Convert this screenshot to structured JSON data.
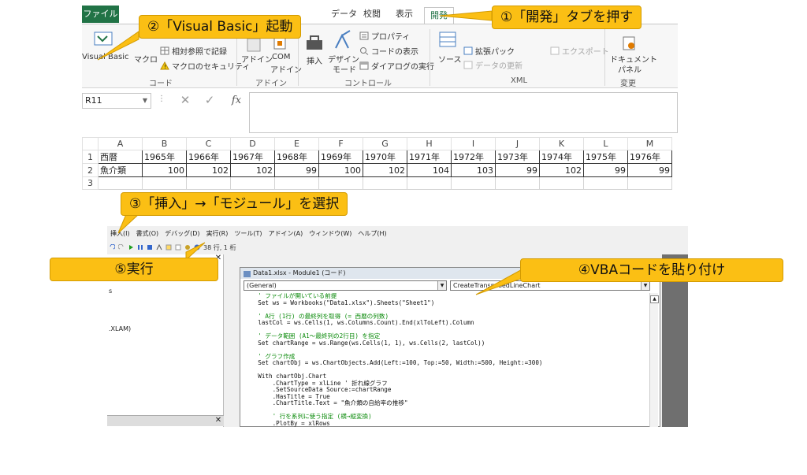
{
  "ribbon": {
    "tabs": [
      "ファイル",
      "データ",
      "校閲",
      "表示",
      "開発"
    ],
    "buttons": {
      "visual_basic": "Visual Basic",
      "macro": "マクロ",
      "relative_ref": "相対参照で記録",
      "macro_security": "マクロのセキュリティ",
      "addin": "アドイン",
      "com_addin_1": "COM",
      "com_addin_2": "アドイン",
      "insert": "挿入",
      "design_mode_1": "デザイン",
      "design_mode_2": "モード",
      "properties": "プロパティ",
      "view_code": "コードの表示",
      "run_dialog": "ダイアログの実行",
      "source": "ソース",
      "expansion_pack": "拡張パック",
      "refresh_data": "データの更新",
      "export": "エクスポート",
      "doc_panel_1": "ドキュメント",
      "doc_panel_2": "パネル"
    },
    "groups": {
      "code": "コード",
      "addin": "アドイン",
      "controls": "コントロール",
      "xml": "XML",
      "modify": "変更"
    }
  },
  "formula_bar": {
    "name_box": "R11",
    "cancel": "✕",
    "enter": "✓",
    "fx": "fx"
  },
  "sheet": {
    "columns": [
      "A",
      "B",
      "C",
      "D",
      "E",
      "F",
      "G",
      "H",
      "I",
      "J",
      "K",
      "L",
      "M"
    ],
    "rows": [
      {
        "num": "1",
        "cells": [
          "西暦",
          "1965年",
          "1966年",
          "1967年",
          "1968年",
          "1969年",
          "1970年",
          "1971年",
          "1972年",
          "1973年",
          "1974年",
          "1975年",
          "1976年"
        ]
      },
      {
        "num": "2",
        "cells": [
          "魚介類",
          "100",
          "102",
          "102",
          "99",
          "100",
          "102",
          "104",
          "103",
          "99",
          "102",
          "99",
          "99"
        ]
      },
      {
        "num": "3",
        "cells": [
          "",
          "",
          "",
          "",
          "",
          "",
          "",
          "",
          "",
          "",
          "",
          "",
          ""
        ]
      }
    ]
  },
  "vbe": {
    "menu": [
      "挿入(I)",
      "書式(O)",
      "デバッグ(D)",
      "実行(R)",
      "ツール(T)",
      "アドイン(A)",
      "ウィンドウ(W)",
      "ヘルプ(H)"
    ],
    "cursor_pos": "38 行, 1 桁",
    "left_text_1": "s",
    "left_text_2": ".XLAM)",
    "window_title": "Data1.xlsx - Module1 (コード)",
    "object_dropdown": "(General)",
    "proc_dropdown": "CreateTransposedLineChart",
    "code": [
      {
        "t": "cm",
        "s": "    ' ファイルが開いている前提"
      },
      {
        "t": "n",
        "s": "    Set ws = Workbooks(\"Data1.xlsx\").Sheets(\"Sheet1\")"
      },
      {
        "t": "n",
        "s": ""
      },
      {
        "t": "cm",
        "s": "    ' A行 (1行) の最終列を取得 (= 西暦の列数)"
      },
      {
        "t": "n",
        "s": "    lastCol = ws.Cells(1, ws.Columns.Count).End(xlToLeft).Column"
      },
      {
        "t": "n",
        "s": ""
      },
      {
        "t": "cm",
        "s": "    ' データ範囲 (A1〜最終列の2行目) を指定"
      },
      {
        "t": "n",
        "s": "    Set chartRange = ws.Range(ws.Cells(1, 1), ws.Cells(2, lastCol))"
      },
      {
        "t": "n",
        "s": ""
      },
      {
        "t": "cm",
        "s": "    ' グラフ作成"
      },
      {
        "t": "n",
        "s": "    Set chartObj = ws.ChartObjects.Add(Left:=100, Top:=50, Width:=500, Height:=300)"
      },
      {
        "t": "n",
        "s": ""
      },
      {
        "t": "n",
        "s": "    With chartObj.Chart"
      },
      {
        "t": "n",
        "s": "        .ChartType = xlLine ' 折れ線グラフ"
      },
      {
        "t": "n",
        "s": "        .SetSourceData Source:=chartRange"
      },
      {
        "t": "n",
        "s": "        .HasTitle = True"
      },
      {
        "t": "n",
        "s": "        .ChartTitle.Text = \"魚介類の自給率の推移\""
      },
      {
        "t": "n",
        "s": ""
      },
      {
        "t": "cm",
        "s": "        ' 行を系列に使う指定 (横→縦変換)"
      },
      {
        "t": "n",
        "s": "        .PlotBy = xlRows"
      }
    ]
  },
  "callouts": {
    "step1": "①「開発」タブを押す",
    "step2": "②「Visual Basic」起動",
    "step3": "③「挿入」→「モジュール」を選択",
    "step4": "④VBAコードを貼り付け",
    "step5": "⑤実行"
  },
  "colors": {
    "excel_green": "#217346",
    "callout": "#fbbf14",
    "comment_green": "#0a8a0a"
  }
}
